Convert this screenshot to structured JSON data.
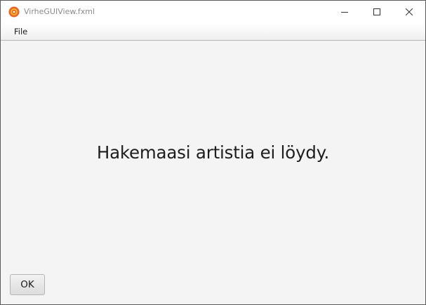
{
  "window": {
    "title": "VirheGUIView.fxml",
    "controls": {
      "minimize_icon": "minimize-icon",
      "maximize_icon": "maximize-icon",
      "close_icon": "close-icon"
    }
  },
  "menubar": {
    "items": [
      {
        "label": "File"
      }
    ]
  },
  "main": {
    "message": "Hakemaasi artistia ei löydy.",
    "ok_label": "OK"
  },
  "colors": {
    "background": "#f4f4f4",
    "app_icon_orange": "#e8622a",
    "app_icon_yellow": "#f6b51e"
  }
}
